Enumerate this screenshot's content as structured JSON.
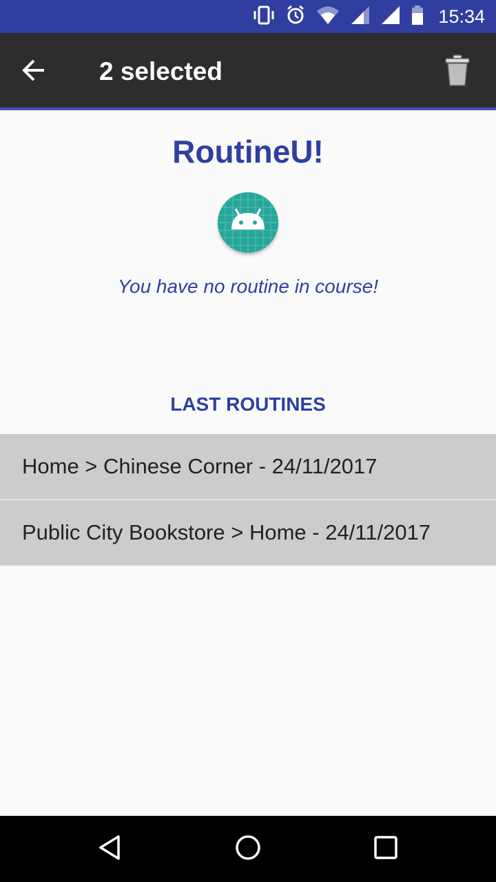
{
  "status_bar": {
    "time": "15:34",
    "icons": [
      "vibrate-icon",
      "alarm-icon",
      "wifi-icon",
      "signal-icon",
      "signal-icon",
      "battery-icon"
    ]
  },
  "action_bar": {
    "title": "2 selected",
    "back_icon": "arrow-back-icon",
    "delete_icon": "trash-icon"
  },
  "main": {
    "app_title": "RoutineU!",
    "logo_icon": "android-logo-icon",
    "empty_message": "You have no routine in course!",
    "section_header": "LAST ROUTINES",
    "routines": [
      {
        "label": "Home > Chinese Corner - 24/11/2017"
      },
      {
        "label": "Public City Bookstore > Home - 24/11/2017"
      }
    ]
  },
  "nav_bar": {
    "icons": [
      "back-triangle-icon",
      "home-circle-icon",
      "recents-square-icon"
    ]
  },
  "colors": {
    "status_bar": "#303f9f",
    "action_bar": "#2d2d2d",
    "accent": "#303f9f",
    "selected_item": "#cccccc",
    "logo": "#26a69a"
  }
}
